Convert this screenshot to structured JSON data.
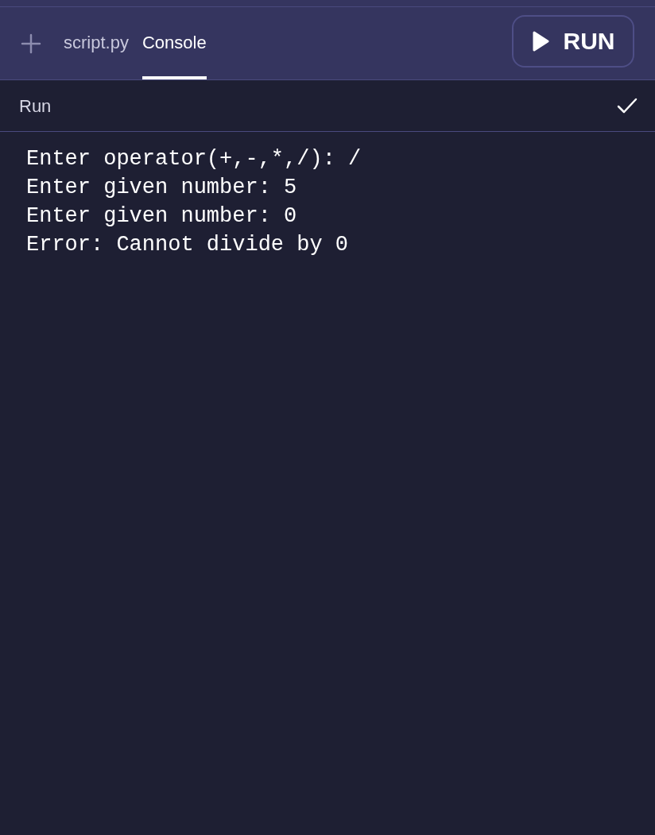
{
  "tabs": [
    {
      "label": "script.py",
      "selected": false
    },
    {
      "label": "Console",
      "selected": true
    }
  ],
  "run_button": {
    "label": "RUN"
  },
  "status_bar": {
    "label": "Run",
    "done": true
  },
  "console": {
    "lines": [
      "Enter operator(+,-,*,/): /",
      "Enter given number: 5",
      "Enter given number: 0",
      "Error: Cannot divide by 0"
    ]
  }
}
